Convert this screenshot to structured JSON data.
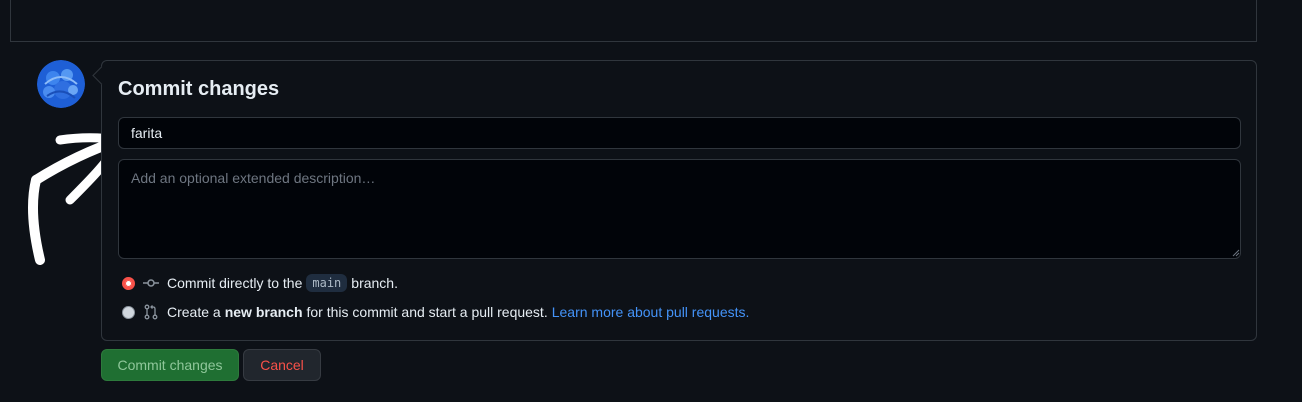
{
  "commit_box": {
    "title": "Commit changes",
    "summary_value": "farita",
    "description_placeholder": "Add an optional extended description…"
  },
  "options": {
    "direct": {
      "selected": true,
      "prefix": "Commit directly to the",
      "branch": "main",
      "suffix": "branch.",
      "icon": "git-commit-icon"
    },
    "new_branch": {
      "selected": false,
      "prefix": "Create a",
      "bold": "new branch",
      "suffix": "for this commit and start a pull request.",
      "link": "Learn more about pull requests.",
      "icon": "git-pull-request-icon"
    }
  },
  "buttons": {
    "commit": "Commit changes",
    "cancel": "Cancel"
  },
  "colors": {
    "background": "#0d1117",
    "border": "#30363d",
    "link": "#4493f8",
    "commit_button": "#1f6f32",
    "cancel_text": "#f85149",
    "radio_checked": "#f85149"
  }
}
